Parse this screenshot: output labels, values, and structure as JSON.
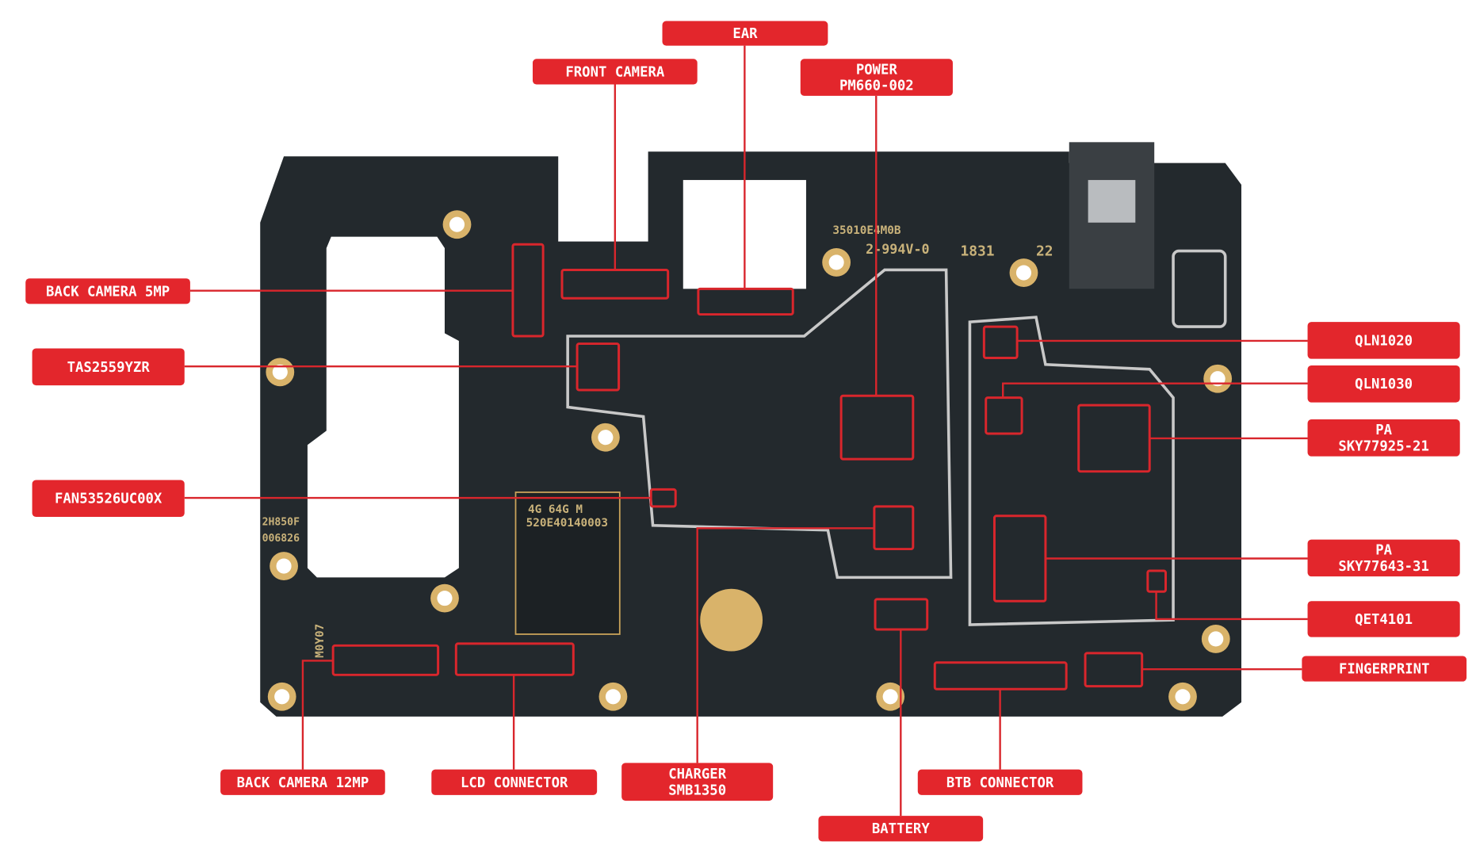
{
  "colors": {
    "label_bg": "#e3262c",
    "leader_line": "#d9262c",
    "board": "#23292d",
    "gold": "#d9b36a",
    "silk_outline": "#c8c8c8"
  },
  "board_markings": {
    "model": "35010E4M0B",
    "code": "2-994V-0",
    "date": "1831",
    "rev": "22",
    "memory": "4G   64G M",
    "memory_code": "520E40140003",
    "serial_a": "2H850F",
    "serial_b": "006826",
    "side_code": "M0Y07"
  },
  "labels": [
    {
      "id": "ear",
      "lines": [
        "EAR"
      ]
    },
    {
      "id": "front-camera",
      "lines": [
        "FRONT CAMERA"
      ]
    },
    {
      "id": "power",
      "lines": [
        "POWER",
        "PM660-002"
      ]
    },
    {
      "id": "back-camera-5mp",
      "lines": [
        "BACK CAMERA 5MP"
      ]
    },
    {
      "id": "tas2559yzr",
      "lines": [
        "TAS2559YZR"
      ]
    },
    {
      "id": "fan53526uc00x",
      "lines": [
        "FAN53526UC00X"
      ]
    },
    {
      "id": "qln1020",
      "lines": [
        "QLN1020"
      ]
    },
    {
      "id": "qln1030",
      "lines": [
        "QLN1030"
      ]
    },
    {
      "id": "pa-sky77925-21",
      "lines": [
        "PA",
        "SKY77925-21"
      ]
    },
    {
      "id": "pa-sky77643-31",
      "lines": [
        "PA",
        "SKY77643-31"
      ]
    },
    {
      "id": "qet4101",
      "lines": [
        "QET4101"
      ]
    },
    {
      "id": "fingerprint",
      "lines": [
        "FINGERPRINT"
      ]
    },
    {
      "id": "back-camera-12mp",
      "lines": [
        "BACK CAMERA 12MP"
      ]
    },
    {
      "id": "lcd-connector",
      "lines": [
        "LCD CONNECTOR"
      ]
    },
    {
      "id": "charger",
      "lines": [
        "CHARGER",
        "SMB1350"
      ]
    },
    {
      "id": "btb-connector",
      "lines": [
        "BTB CONNECTOR"
      ]
    },
    {
      "id": "battery",
      "lines": [
        "BATTERY"
      ]
    }
  ]
}
